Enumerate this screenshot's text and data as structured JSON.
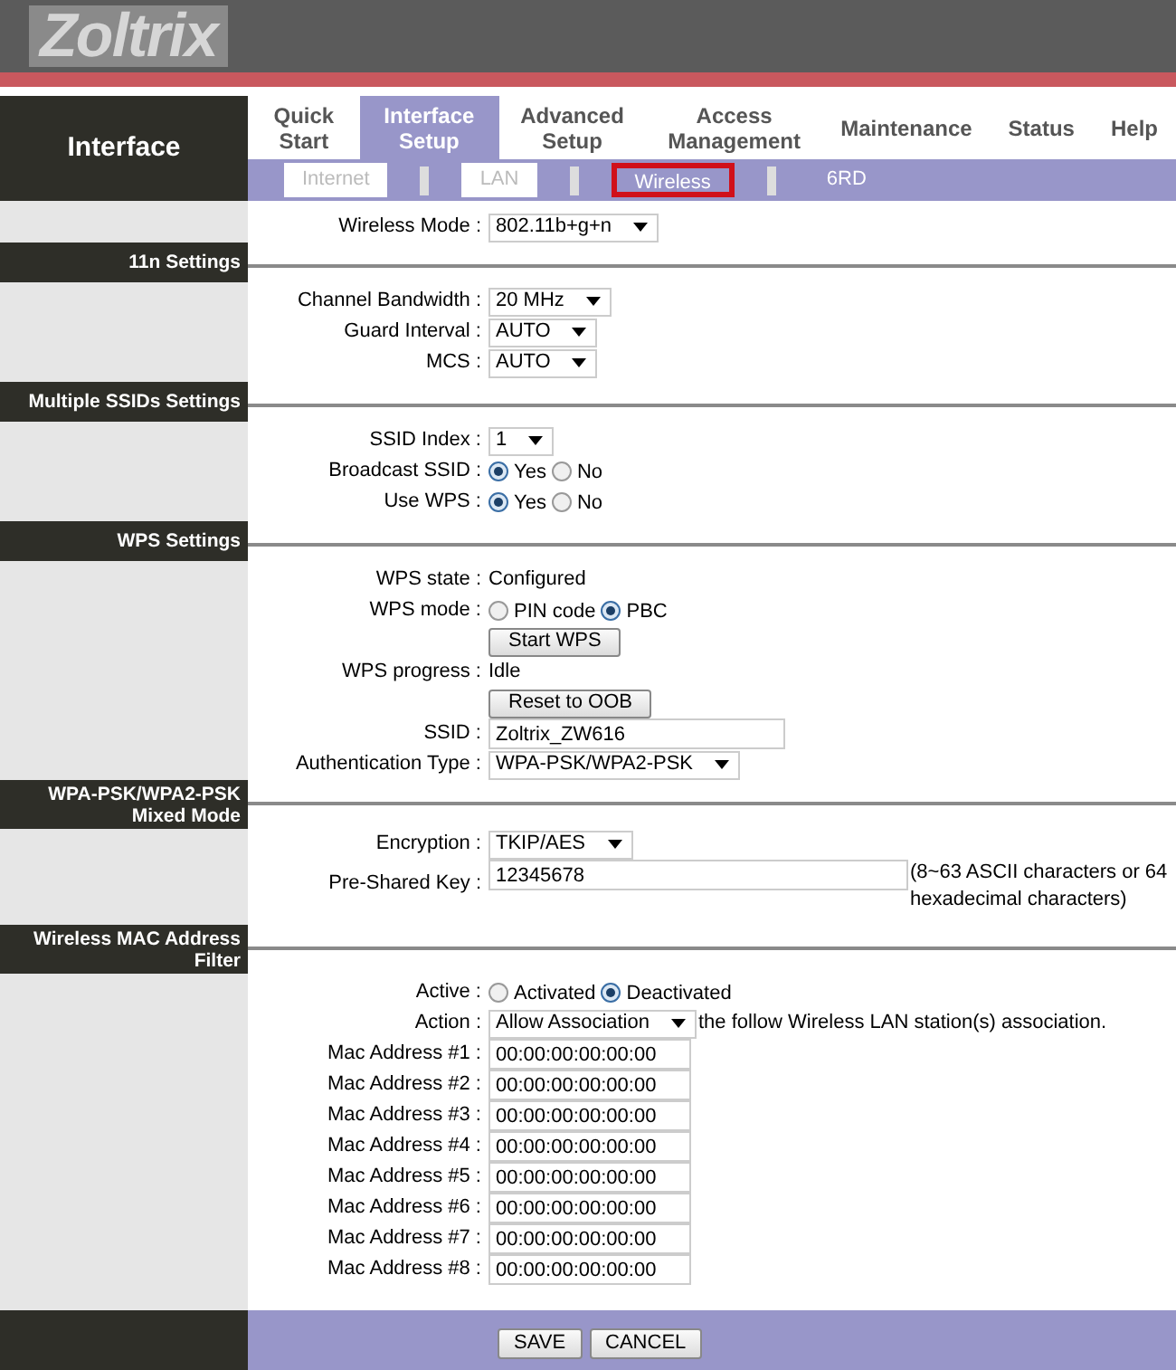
{
  "logo": "Zoltrix",
  "page_title": "Interface",
  "tabs": [
    {
      "label": "Quick Start",
      "selected": false
    },
    {
      "label": "Interface Setup",
      "selected": true
    },
    {
      "label": "Advanced Setup",
      "selected": false
    },
    {
      "label": "Access Management",
      "selected": false
    },
    {
      "label": "Maintenance",
      "selected": false
    },
    {
      "label": "Status",
      "selected": false
    },
    {
      "label": "Help",
      "selected": false
    }
  ],
  "subtabs": [
    {
      "label": "Internet",
      "selected": false
    },
    {
      "label": "LAN",
      "selected": false
    },
    {
      "label": "Wireless",
      "selected": true
    },
    {
      "label": "6RD",
      "selected": false
    }
  ],
  "sections": [
    {
      "rows": [
        {
          "kind": "select",
          "label": "Wireless Mode :",
          "value": "802.11b+g+n"
        }
      ]
    },
    {
      "title": "11n Settings",
      "rows": [
        {
          "kind": "select",
          "label": "Channel Bandwidth :",
          "value": "20 MHz"
        },
        {
          "kind": "select",
          "label": "Guard Interval :",
          "value": "AUTO"
        },
        {
          "kind": "select",
          "label": "MCS :",
          "value": "AUTO"
        }
      ]
    },
    {
      "title": "Multiple SSIDs Settings",
      "rows": [
        {
          "kind": "select",
          "label": "SSID Index :",
          "value": "1"
        },
        {
          "kind": "radio",
          "label": "Broadcast SSID :",
          "options": [
            {
              "label": "Yes",
              "selected": true
            },
            {
              "label": "No",
              "selected": false
            }
          ]
        },
        {
          "kind": "radio",
          "label": "Use WPS :",
          "options": [
            {
              "label": "Yes",
              "selected": true
            },
            {
              "label": "No",
              "selected": false
            }
          ]
        }
      ]
    },
    {
      "title": "WPS Settings",
      "rows": [
        {
          "kind": "text",
          "label": "WPS state :",
          "value": "Configured"
        },
        {
          "kind": "radio",
          "label": "WPS mode :",
          "options": [
            {
              "label": "PIN code",
              "selected": false
            },
            {
              "label": "PBC",
              "selected": true
            }
          ]
        },
        {
          "kind": "button",
          "value": "Start WPS"
        },
        {
          "kind": "text",
          "label": "WPS progress :",
          "value": "Idle"
        },
        {
          "kind": "button",
          "value": "Reset to OOB"
        },
        {
          "kind": "input",
          "label": "SSID :",
          "value": "Zoltrix_ZW616"
        },
        {
          "kind": "select",
          "label": "Authentication Type :",
          "value": "WPA-PSK/WPA2-PSK"
        }
      ]
    },
    {
      "title": "WPA-PSK/WPA2-PSK Mixed Mode",
      "rows": [
        {
          "kind": "select",
          "label": "Encryption :",
          "value": "TKIP/AES"
        },
        {
          "kind": "input",
          "label": "Pre-Shared Key :",
          "value": "12345678",
          "note": "(8~63 ASCII characters or 64 hexadecimal characters)"
        }
      ]
    },
    {
      "title": "Wireless MAC Address Filter",
      "rows": [
        {
          "kind": "radio",
          "label": "Active :",
          "options": [
            {
              "label": "Activated",
              "selected": false
            },
            {
              "label": "Deactivated",
              "selected": true
            }
          ]
        },
        {
          "kind": "select",
          "label": "Action :",
          "value": "Allow Association",
          "note": "the follow Wireless LAN station(s) association."
        },
        {
          "kind": "input",
          "label": "Mac Address #1 :",
          "value": "00:00:00:00:00:00"
        },
        {
          "kind": "input",
          "label": "Mac Address #2 :",
          "value": "00:00:00:00:00:00"
        },
        {
          "kind": "input",
          "label": "Mac Address #3 :",
          "value": "00:00:00:00:00:00"
        },
        {
          "kind": "input",
          "label": "Mac Address #4 :",
          "value": "00:00:00:00:00:00"
        },
        {
          "kind": "input",
          "label": "Mac Address #5 :",
          "value": "00:00:00:00:00:00"
        },
        {
          "kind": "input",
          "label": "Mac Address #6 :",
          "value": "00:00:00:00:00:00"
        },
        {
          "kind": "input",
          "label": "Mac Address #7 :",
          "value": "00:00:00:00:00:00"
        },
        {
          "kind": "input",
          "label": "Mac Address #8 :",
          "value": "00:00:00:00:00:00"
        }
      ]
    }
  ],
  "footer_buttons": [
    "SAVE",
    "CANCEL"
  ]
}
